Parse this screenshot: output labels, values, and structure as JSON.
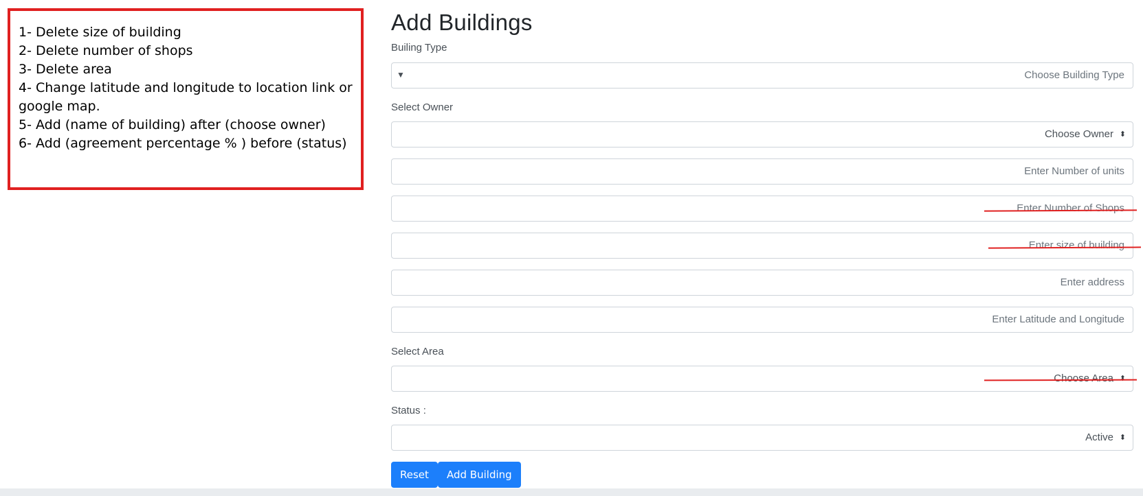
{
  "notes": [
    "1- Delete size of building",
    "2- Delete number of shops",
    "3- Delete area",
    "4- Change latitude and longitude to location link or",
    "google map.",
    "5- Add (name of building) after (choose owner)",
    "6- Add (agreement percentage % ) before (status)"
  ],
  "form": {
    "title": "Add Buildings",
    "building_type_label": "Builing Type",
    "building_type_placeholder": "Choose Building Type",
    "owner_label": "Select Owner",
    "owner_placeholder": "Choose Owner",
    "units_placeholder": "Enter Number of units",
    "shops_placeholder": "Enter Number of Shops",
    "size_placeholder": "Enter size of building",
    "address_placeholder": "Enter address",
    "latlng_placeholder": "Enter Latitude and Longitude",
    "area_label": "Select Area",
    "area_placeholder": "Choose Area",
    "status_label": "Status :",
    "status_value": "Active"
  },
  "buttons": {
    "reset": "Reset",
    "add": "Add Building"
  },
  "colors": {
    "annotation_red": "#e02020",
    "primary_button": "#1c7ffb"
  },
  "icons": {
    "building_type_arrow": "triangle-down-icon",
    "select_caret": "up-down-caret-icon"
  }
}
